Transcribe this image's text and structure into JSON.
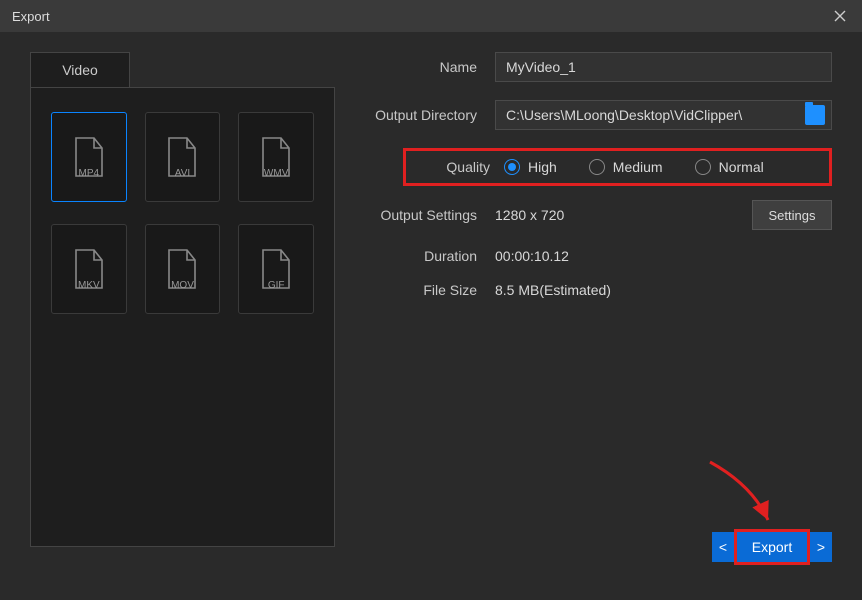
{
  "window": {
    "title": "Export"
  },
  "tabs": {
    "video": "Video"
  },
  "formats": [
    {
      "id": "mp4",
      "label": "MP4",
      "selected": true
    },
    {
      "id": "avi",
      "label": "AVI",
      "selected": false
    },
    {
      "id": "wmv",
      "label": "WMV",
      "selected": false
    },
    {
      "id": "mkv",
      "label": "MKV",
      "selected": false
    },
    {
      "id": "mov",
      "label": "MOV",
      "selected": false
    },
    {
      "id": "gif",
      "label": "GIF",
      "selected": false
    }
  ],
  "fields": {
    "name_label": "Name",
    "name_value": "MyVideo_1",
    "dir_label": "Output Directory",
    "dir_value": "C:\\Users\\MLoong\\Desktop\\VidClipper\\",
    "quality_label": "Quality",
    "quality_options": {
      "high": "High",
      "medium": "Medium",
      "normal": "Normal"
    },
    "quality_selected": "high",
    "settings_label": "Output Settings",
    "settings_value": "1280 x 720",
    "settings_button": "Settings",
    "duration_label": "Duration",
    "duration_value": "00:00:10.12",
    "filesize_label": "File Size",
    "filesize_value": "8.5 MB(Estimated)"
  },
  "buttons": {
    "export": "Export",
    "prev": "<",
    "next": ">"
  }
}
